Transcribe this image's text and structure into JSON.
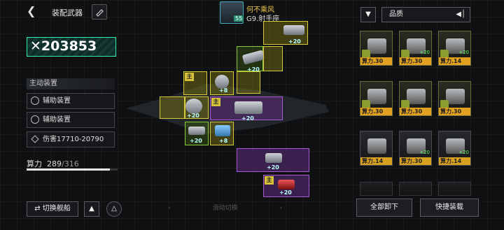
{
  "header": {
    "title": "装配武器"
  },
  "player": {
    "name": "何不乘风",
    "subtitle": "G9.射手座",
    "level": "55"
  },
  "power": {
    "value": "203853"
  },
  "active_devices": {
    "label": "主动装置",
    "items": [
      {
        "label": "辅助装置"
      },
      {
        "label": "辅助装置"
      },
      {
        "label": "伤害17710-20790"
      }
    ]
  },
  "computing": {
    "label": "算力",
    "used": "289",
    "total": "/316",
    "fraction": 0.915
  },
  "footer": {
    "switch_ship": "切换舰船",
    "swipe_hint": "滑动切换"
  },
  "slots": {
    "lv20": "+20",
    "lv8": "+8",
    "main": "主"
  },
  "inventory": {
    "filter_label": "品质",
    "cards": [
      {
        "power": "算力.30"
      },
      {
        "power": "算力.30"
      },
      {
        "power": "算力.14"
      },
      {
        "power": "算力.30"
      },
      {
        "power": "算力.30"
      },
      {
        "power": "算力.30"
      },
      {
        "power": "算力.14"
      },
      {
        "power": "算力.30"
      },
      {
        "power": "算力.14"
      }
    ],
    "unequip_all": "全部卸下",
    "quick_equip": "快捷装载"
  }
}
